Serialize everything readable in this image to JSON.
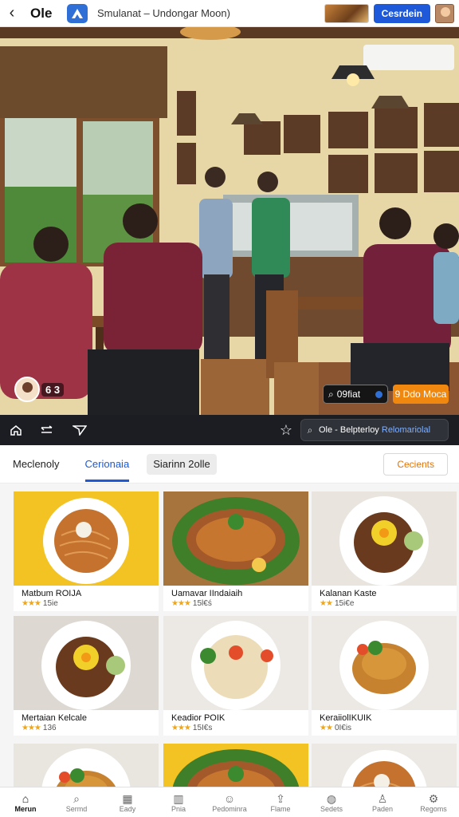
{
  "topbar": {
    "back_icon": "chevron-left-icon",
    "app_name": "Ole",
    "app_icon": "logo-icon",
    "title": "Smulanat – Undongar Moon)",
    "cta_label": "Cesrdein"
  },
  "hero": {
    "avatar_count": "6 3",
    "pill_label": "09fiat",
    "cta_label": "9 Ddo Moca"
  },
  "strip": {
    "icons": [
      "home-icon",
      "arrow-right-icon",
      "send-icon",
      "star-icon"
    ],
    "search_prefix": "Ole - Belpterloy",
    "search_highlight": "Relomariolal"
  },
  "tabs": {
    "items": [
      "Meclenoly",
      "Cerionaia",
      "Siarinn 2olle"
    ],
    "active": 1,
    "button_label": "Cecients"
  },
  "dishes": [
    {
      "name": "Matbum ROIJA",
      "rating": "★★★",
      "reviews": "15ie",
      "plate": "noodles",
      "bg": "#f2c322"
    },
    {
      "name": "Uamavar IIndaiaih",
      "rating": "★★★",
      "reviews": "15l€ś",
      "plate": "fish",
      "bg": "#a8743d"
    },
    {
      "name": "Kalanan Kaste",
      "rating": "★★",
      "reviews": "15i€e",
      "plate": "stew",
      "bg": "#e9e5de"
    },
    {
      "name": "Mertaian Kelcale",
      "rating": "★★★",
      "reviews": "136",
      "plate": "stew",
      "bg": "#ddd9d2"
    },
    {
      "name": "Keadior POIK",
      "rating": "★★★",
      "reviews": "15I€s",
      "plate": "rice",
      "bg": "#ece9e4"
    },
    {
      "name": "KeraiiolIKUIK",
      "rating": "★★",
      "reviews": "0I€is",
      "plate": "chicken",
      "bg": "#ece9e4"
    },
    {
      "name": "",
      "rating": "",
      "reviews": "",
      "plate": "chicken",
      "bg": "#e9e6e0"
    },
    {
      "name": "",
      "rating": "",
      "reviews": "",
      "plate": "fish",
      "bg": "#f2c322"
    },
    {
      "name": "",
      "rating": "",
      "reviews": "",
      "plate": "noodles",
      "bg": "#ece9e4"
    }
  ],
  "bottomnav": [
    {
      "label": "Merun",
      "icon": "home-icon"
    },
    {
      "label": "Sermd",
      "icon": "search-icon"
    },
    {
      "label": "Eady",
      "icon": "calendar-icon"
    },
    {
      "label": "Pnia",
      "icon": "building-icon"
    },
    {
      "label": "Pedominra",
      "icon": "smile-icon"
    },
    {
      "label": "Flame",
      "icon": "upload-icon"
    },
    {
      "label": "Sedets",
      "icon": "globe-icon"
    },
    {
      "label": "Paden",
      "icon": "user-icon"
    },
    {
      "label": "Regoms",
      "icon": "user-gear-icon"
    }
  ],
  "colors": {
    "accent": "#1d59d9",
    "orange": "#f0870f",
    "star": "#f2a516"
  }
}
